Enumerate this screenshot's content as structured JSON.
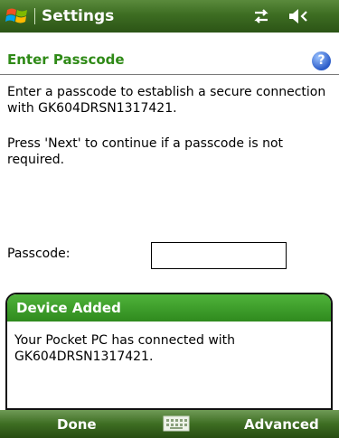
{
  "titlebar": {
    "title": "Settings",
    "icons": [
      "windows-start-icon",
      "network-icon",
      "volume-icon"
    ]
  },
  "page": {
    "title": "Enter Passcode",
    "help_glyph": "?",
    "paragraph1": "Enter a passcode to establish a secure connection with GK604DRSN1317421.",
    "paragraph2": "Press 'Next' to continue if a passcode is not required.",
    "passcode_label": "Passcode:",
    "passcode_value": ""
  },
  "notification": {
    "title": "Device Added",
    "text": "Your Pocket PC has connected with GK604DRSN1317421."
  },
  "softkeys": {
    "left": "Done",
    "right": "Advanced",
    "middle_icon": "keyboard-icon"
  },
  "colors": {
    "title_green": "#3d6d22",
    "accent_green": "#2f8a17",
    "notify_green": "#3fa02c",
    "help_blue": "#2a5bc8"
  }
}
